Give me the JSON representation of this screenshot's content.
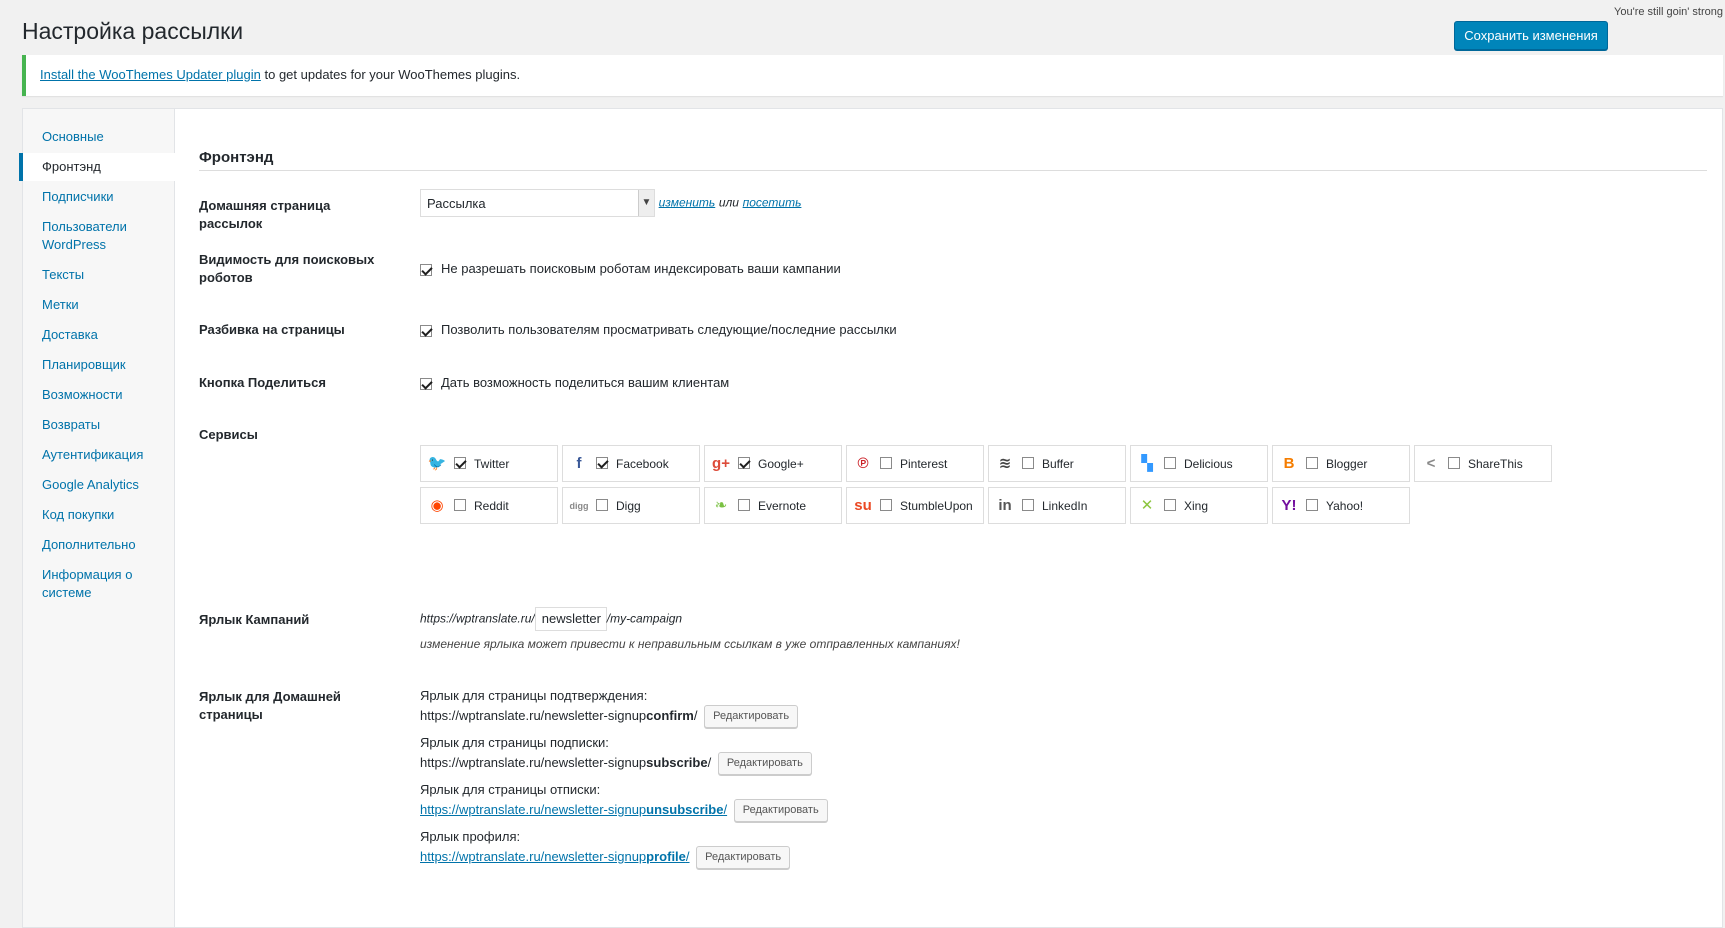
{
  "top_note": "You're still goin' strong",
  "page_title": "Настройка рассылки",
  "save_label": "Сохранить изменения",
  "notice": {
    "link_text": "Install the WooThemes Updater plugin",
    "rest_text": " to get updates for your WooThemes plugins."
  },
  "sidebar": {
    "items": [
      {
        "label": "Основные"
      },
      {
        "label": "Фронтэнд"
      },
      {
        "label": "Подписчики"
      },
      {
        "label": "Пользователи WordPress"
      },
      {
        "label": "Тексты"
      },
      {
        "label": "Метки"
      },
      {
        "label": "Доставка"
      },
      {
        "label": "Планировщик"
      },
      {
        "label": "Возможности"
      },
      {
        "label": "Возвраты"
      },
      {
        "label": "Аутентификация"
      },
      {
        "label": "Google Analytics"
      },
      {
        "label": "Код покупки"
      },
      {
        "label": "Дополнительно"
      },
      {
        "label": "Информация о системе"
      }
    ]
  },
  "section_title": "Фронтэнд",
  "homepage": {
    "label": "Домашняя страница рассылок",
    "selected": "Рассылка",
    "change": "изменить",
    "or": "или",
    "visit": "посетить"
  },
  "visibility": {
    "label": "Видимость для поисковых роботов",
    "checkbox": "Не разрешать поисковым роботам индексировать ваши кампании",
    "checked": true
  },
  "pagination": {
    "label": "Разбивка на страницы",
    "checkbox": "Позволить пользователям просматривать следующие/последние рассылки",
    "checked": true
  },
  "share": {
    "label": "Кнопка Поделиться",
    "checkbox": "Дать возможность поделиться вашим клиентам",
    "checked": true
  },
  "services": {
    "label": "Сервисы",
    "items": [
      {
        "name": "Twitter",
        "checked": true,
        "icon": "twitter-icon",
        "glyph": "🐦",
        "color": "#55acee"
      },
      {
        "name": "Facebook",
        "checked": true,
        "icon": "facebook-icon",
        "glyph": "f",
        "color": "#3b5998"
      },
      {
        "name": "Google+",
        "checked": true,
        "icon": "googleplus-icon",
        "glyph": "g+",
        "color": "#dd4b39"
      },
      {
        "name": "Pinterest",
        "checked": false,
        "icon": "pinterest-icon",
        "glyph": "℗",
        "color": "#cb2027"
      },
      {
        "name": "Buffer",
        "checked": false,
        "icon": "buffer-icon",
        "glyph": "≋",
        "color": "#444444"
      },
      {
        "name": "Delicious",
        "checked": false,
        "icon": "delicious-icon",
        "glyph": "▚",
        "color": "#3399ff"
      },
      {
        "name": "Blogger",
        "checked": false,
        "icon": "blogger-icon",
        "glyph": "B",
        "color": "#f57d00"
      },
      {
        "name": "ShareThis",
        "checked": false,
        "icon": "sharethis-icon",
        "glyph": "<",
        "color": "#888888"
      },
      {
        "name": "Reddit",
        "checked": false,
        "icon": "reddit-icon",
        "glyph": "◉",
        "color": "#ff4500"
      },
      {
        "name": "Digg",
        "checked": false,
        "icon": "digg-icon",
        "glyph": "digg",
        "color": "#888888"
      },
      {
        "name": "Evernote",
        "checked": false,
        "icon": "evernote-icon",
        "glyph": "❧",
        "color": "#7ac142"
      },
      {
        "name": "StumbleUpon",
        "checked": false,
        "icon": "stumbleupon-icon",
        "glyph": "su",
        "color": "#eb4924"
      },
      {
        "name": "LinkedIn",
        "checked": false,
        "icon": "linkedin-icon",
        "glyph": "in",
        "color": "#555555"
      },
      {
        "name": "Xing",
        "checked": false,
        "icon": "xing-icon",
        "glyph": "✕",
        "color": "#8cc63f"
      },
      {
        "name": "Yahoo!",
        "checked": false,
        "icon": "yahoo-icon",
        "glyph": "Y!",
        "color": "#720e9e"
      }
    ]
  },
  "campaign_slug": {
    "label": "Ярлык Кампаний",
    "prefix": "https://wptranslate.ru/",
    "value": "newsletter",
    "suffix": "/my-campaign",
    "hint": "изменение ярлыка может привести к неправильным ссылкам в уже отправленных кампаниях!"
  },
  "home_slug": {
    "label": "Ярлык для Домашней страницы",
    "edit_label": "Редактировать",
    "entries": [
      {
        "caption": "Ярлык для страницы подтверждения:",
        "base": "https://wptranslate.ru/newsletter-signup",
        "slug": "confirm",
        "end": "/",
        "link": false
      },
      {
        "caption": "Ярлык для страницы подписки:",
        "base": "https://wptranslate.ru/newsletter-signup",
        "slug": "subscribe",
        "end": "/",
        "link": false
      },
      {
        "caption": "Ярлык для страницы отписки:",
        "base": "https://wptranslate.ru/newsletter-signup",
        "slug": "unsubscribe",
        "end": "/",
        "link": true
      },
      {
        "caption": "Ярлык профиля:",
        "base": "https://wptranslate.ru/newsletter-signup",
        "slug": "profile",
        "end": "/",
        "link": true
      }
    ]
  }
}
